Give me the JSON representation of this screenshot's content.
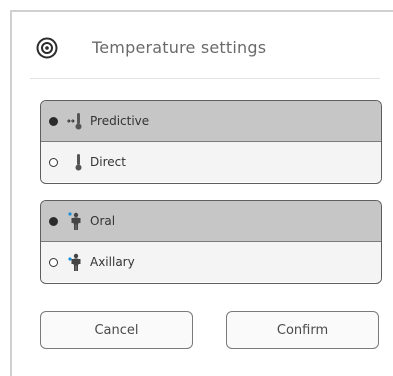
{
  "header": {
    "title": "Temperature settings",
    "icon": "target-icon"
  },
  "mode_group": {
    "options": [
      {
        "label": "Predictive",
        "selected": true,
        "icon": "thermometer-predictive-icon"
      },
      {
        "label": "Direct",
        "selected": false,
        "icon": "thermometer-icon"
      }
    ]
  },
  "site_group": {
    "options": [
      {
        "label": "Oral",
        "selected": true,
        "icon": "person-oral-icon"
      },
      {
        "label": "Axillary",
        "selected": false,
        "icon": "person-axillary-icon"
      }
    ]
  },
  "buttons": {
    "cancel": "Cancel",
    "confirm": "Confirm"
  },
  "colors": {
    "selected_row": "#c6c6c6",
    "unselected_row": "#f4f4f4",
    "accent": "#1a8fd6"
  }
}
